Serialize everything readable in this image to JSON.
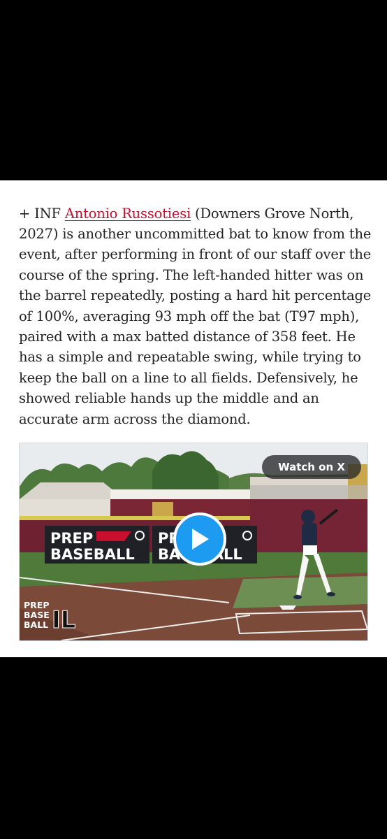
{
  "article": {
    "intro": "+ INF ",
    "player_name": "Antonio Russotiesi",
    "body": " (Downers Grove North, 2027) is another uncommitted bat to know from the event, after performing in front of our staff over the course of the spring. The left-handed hitter was on the barrel repeatedly, posting a hard hit percentage of 100%, averaging 93 mph off the bat (T97 mph), paired with a max batted distance of 358 feet. He has a simple and repeatable swing, while trying to keep the ball on a line to all fields. Defensively, he showed reliable hands up the middle and an accurate arm across the diamond."
  },
  "video": {
    "watch_label": "Watch on X",
    "banner_line1": "PREP",
    "banner_line2": "BASEBALL",
    "logo_line1": "PREP",
    "logo_line2": "BASE",
    "logo_line3": "BALL",
    "logo_mark": "IL"
  },
  "colors": {
    "link": "#c8102e",
    "play_button": "#1d9bf0",
    "background": "#000000"
  }
}
